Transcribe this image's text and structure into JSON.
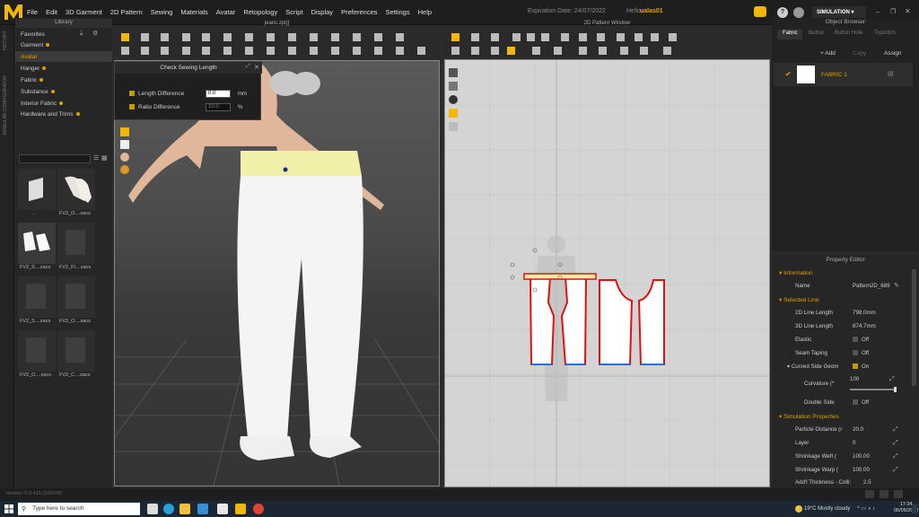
{
  "app": {
    "menus": [
      "File",
      "Edit",
      "3D Garment",
      "2D Pattern",
      "Sewing",
      "Materials",
      "Avatar",
      "Retopology",
      "Script",
      "Display",
      "Preferences",
      "Settings",
      "Help"
    ],
    "expiry_label": "Expiration Date: 24/07/2022",
    "hello_label": "Hello,",
    "username": "ualas01",
    "mode_label": "SIMULATION",
    "help_icon": "?"
  },
  "left_tabs": [
    "HISTORY",
    "MODULAR CONFIGURATOR"
  ],
  "library": {
    "title": "Library",
    "items": [
      "Favorites",
      "Garment",
      "Avatar",
      "Hanger",
      "Fabric",
      "Substance",
      "Interior Fabric",
      "Hardware and Trims"
    ],
    "selected_index": 2,
    "thumbs": [
      {
        "label": ".."
      },
      {
        "label": "FV2_O....zacs"
      },
      {
        "label": "FV2_S....zacs"
      },
      {
        "label": "FV2_Fl....zacs"
      },
      {
        "label": "FV2_S....zacs"
      },
      {
        "label": "FV2_O....zacs"
      },
      {
        "label": "FV2_O....zacs"
      },
      {
        "label": "FV2_C....zacs"
      }
    ]
  },
  "view3d": {
    "title": "jeans.zprj]"
  },
  "dialog": {
    "title": "Check Sewing Length",
    "rows": [
      {
        "label": "Length Difference",
        "value": "0.0",
        "unit": "mm"
      },
      {
        "label": "Ratio Difference",
        "value": "10.0",
        "unit": "%"
      }
    ]
  },
  "view2d": {
    "title": "2D Pattern Window"
  },
  "object_browser": {
    "title": "Object Browser",
    "tabs": [
      "Fabric",
      "Button",
      "Button Hole",
      "Topstitch"
    ],
    "add_label": "+ Add",
    "copy_label": "Copy",
    "assign_label": "Assign",
    "fabric_name": "FABRIC 1"
  },
  "property_editor": {
    "title": "Property Editor",
    "sections": {
      "information": "Information",
      "selected_line": "Selected Line",
      "simulation": "Simulation Properties"
    },
    "name_label": "Name",
    "name_value": "Pattern2D_689",
    "line2d_label": "2D Line Length",
    "line2d_value": "798.0mm",
    "line3d_label": "3D Line Length",
    "line3d_value": "874.7mm",
    "elastic_label": "Elastic",
    "elastic_value": "Off",
    "taping_label": "Seam Taping",
    "taping_value": "Off",
    "curved_label": "Curved Side Geom",
    "curved_value": "On",
    "curvature_label": "Curvature (*",
    "curvature_value": "100",
    "double_label": "Double Side",
    "double_value": "Off",
    "particle_label": "Particle Distance (r",
    "particle_value": "20.0",
    "layer_label": "Layer",
    "layer_value": "0",
    "weft_label": "Shrinkage Weft (",
    "weft_value": "100.00",
    "warp_label": "Shrinkage Warp (",
    "warp_value": "100.00",
    "thick_label": "Add'l Thickness - Colli:",
    "thick_value": "2.5"
  },
  "status_text": "Version: 6.0.415 (106009)",
  "taskbar": {
    "search_placeholder": "Type here to search",
    "weather": "19°C  Mostly cloudy",
    "time": "17:34",
    "date": "05/05/2022"
  },
  "colors": {
    "accent": "#e0a000",
    "pattern_outline": "#e01010",
    "pattern_hem": "#2a6fd6"
  }
}
